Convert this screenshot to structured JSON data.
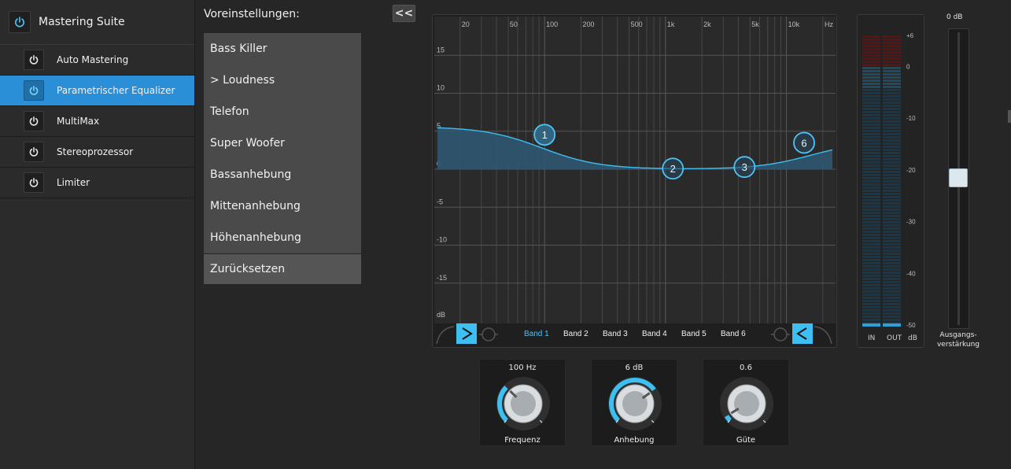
{
  "sidebar": {
    "title": "Mastering Suite",
    "modules": [
      {
        "label": "Auto Mastering",
        "active": false
      },
      {
        "label": "Parametrischer Equalizer",
        "active": true
      },
      {
        "label": "MultiMax",
        "active": false
      },
      {
        "label": "Stereoprozessor",
        "active": false
      },
      {
        "label": "Limiter",
        "active": false
      }
    ]
  },
  "presets": {
    "title": "Voreinstellungen:",
    "items": [
      "Bass Killer",
      "> Loudness",
      "Telefon",
      "Super Woofer",
      "Bassanhebung",
      "Mittenanhebung",
      "Höhenanhebung"
    ],
    "reset_label": "Zurücksetzen"
  },
  "collapse_label": "<<",
  "eq": {
    "freq_labels": [
      "20",
      "50",
      "100",
      "200",
      "500",
      "1k",
      "2k",
      "5k",
      "10k",
      "Hz"
    ],
    "db_labels": [
      "15",
      "10",
      "5",
      "0",
      "-5",
      "-10",
      "-15",
      "dB"
    ],
    "bands": [
      "Band 1",
      "Band 2",
      "Band 3",
      "Band 4",
      "Band 5",
      "Band 6"
    ],
    "selected_band": "Band 1",
    "nodes": [
      "1",
      "2",
      "3",
      "6"
    ],
    "accent_color": "#3dbff1"
  },
  "meter": {
    "in_label": "IN",
    "out_label": "OUT",
    "db_label": "dB",
    "scale": [
      "+6",
      "0",
      "-10",
      "-20",
      "-30",
      "-40",
      "-50"
    ]
  },
  "output": {
    "value": "0 dB",
    "label_line1": "Ausgangs-",
    "label_line2": "verstärkung"
  },
  "knobs": [
    {
      "name": "Frequenz",
      "value": "100 Hz",
      "fraction": 0.33
    },
    {
      "name": "Anhebung",
      "value": "6 dB",
      "fraction": 0.7
    },
    {
      "name": "Güte",
      "value": "0.6",
      "fraction": 0.05
    }
  ]
}
